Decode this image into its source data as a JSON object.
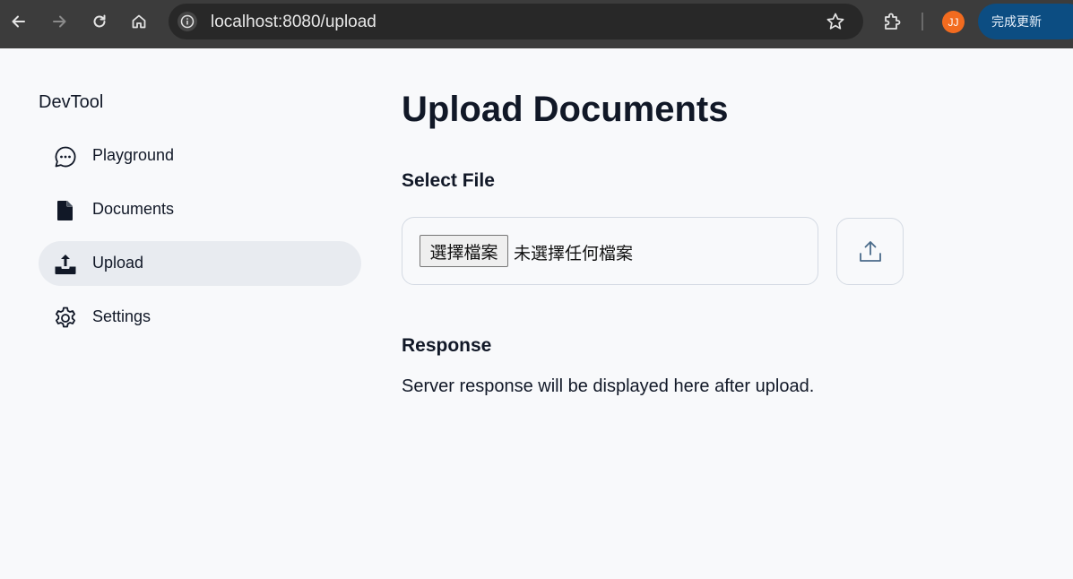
{
  "browser": {
    "url": "localhost:8080/upload",
    "avatar_initials": "JJ",
    "update_label": "完成更新"
  },
  "sidebar": {
    "brand": "DevTool",
    "items": [
      {
        "label": "Playground",
        "icon": "chat-bubble-icon"
      },
      {
        "label": "Documents",
        "icon": "document-icon"
      },
      {
        "label": "Upload",
        "icon": "upload-tray-icon",
        "active": true
      },
      {
        "label": "Settings",
        "icon": "gear-icon"
      }
    ]
  },
  "main": {
    "title": "Upload Documents",
    "select_heading": "Select File",
    "file_button_label": "選擇檔案",
    "file_status": "未選擇任何檔案",
    "response_heading": "Response",
    "response_text": "Server response will be displayed here after upload."
  },
  "colors": {
    "chrome_bg": "#3c3c3c",
    "page_bg": "#f8f9fb",
    "active_item_bg": "#e8ebf0",
    "avatar_bg": "#f26b1f",
    "update_bg": "#0c4d82",
    "upload_icon": "#4a6b8a"
  }
}
